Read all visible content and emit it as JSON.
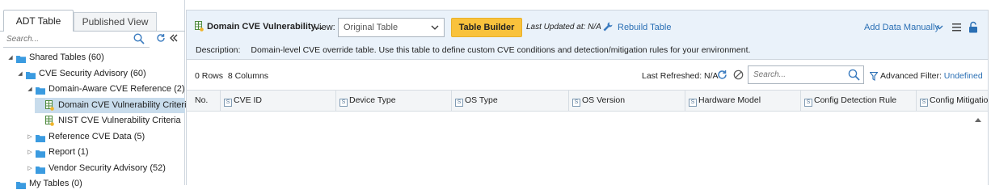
{
  "left_panel": {
    "tabs": [
      {
        "label": "ADT Table",
        "active": true
      },
      {
        "label": "Published View",
        "active": false
      }
    ],
    "search_placeholder": "Search...",
    "tree": [
      {
        "label": "Shared Tables (60)",
        "level": 0,
        "expanded": true,
        "kind": "folder"
      },
      {
        "label": "CVE Security Advisory (60)",
        "level": 1,
        "expanded": true,
        "kind": "folder"
      },
      {
        "label": "Domain-Aware CVE Reference (2)",
        "level": 2,
        "expanded": true,
        "kind": "folder"
      },
      {
        "label": "Domain CVE Vulnerability Criteria",
        "level": 3,
        "kind": "table",
        "selected": true
      },
      {
        "label": "NIST CVE Vulnerability Criteria",
        "level": 3,
        "kind": "table"
      },
      {
        "label": "Reference CVE Data (5)",
        "level": 2,
        "expanded": false,
        "kind": "folder"
      },
      {
        "label": "Report (1)",
        "level": 2,
        "expanded": false,
        "kind": "folder"
      },
      {
        "label": "Vendor Security Advisory (52)",
        "level": 2,
        "expanded": false,
        "kind": "folder"
      },
      {
        "label": "My Tables (0)",
        "level": 0,
        "kind": "folder"
      }
    ]
  },
  "header": {
    "title": "Domain CVE Vulnerability...",
    "view_label": "View:",
    "view_selected": "Original Table",
    "table_builder_label": "Table Builder",
    "last_updated": "Last Updated at: N/A",
    "rebuild_label": "Rebuild Table",
    "add_data_label": "Add Data Manually",
    "description_label": "Description:",
    "description_text": "Domain-level CVE override table. Use this table to define custom CVE conditions and detection/mitigation rules for your environment."
  },
  "toolbar": {
    "rows_info": "0 Rows  8 Columns",
    "last_refreshed": "Last Refreshed: N/A",
    "search_placeholder": "Search...",
    "advanced_filter_label": "Advanced Filter:",
    "advanced_filter_value": "Undefined"
  },
  "table": {
    "columns": [
      {
        "label": "No.",
        "typed": false
      },
      {
        "label": "CVE ID",
        "typed": true
      },
      {
        "label": "Device Type",
        "typed": true
      },
      {
        "label": "OS Type",
        "typed": true
      },
      {
        "label": "OS Version",
        "typed": true
      },
      {
        "label": "Hardware Model",
        "typed": true
      },
      {
        "label": "Config Detection Rule",
        "typed": true
      },
      {
        "label": "Config Mitigation",
        "typed": true
      }
    ],
    "type_badge": "S"
  },
  "colors": {
    "accent": "#2a6fb4",
    "button_yellow": "#f9c23c",
    "header_bg": "#eaf2fa",
    "selected_row": "#c8dcec",
    "folder": "#3b9be0",
    "table_icon": "#4e8a3e"
  },
  "icons": [
    "search-icon",
    "refresh-icon",
    "collapse-left-icon",
    "folder-icon",
    "table-icon",
    "wrench-icon",
    "chevron-down-icon",
    "menu-icon",
    "lock-icon",
    "filter-off-icon",
    "funnel-icon",
    "scroll-up-icon"
  ]
}
